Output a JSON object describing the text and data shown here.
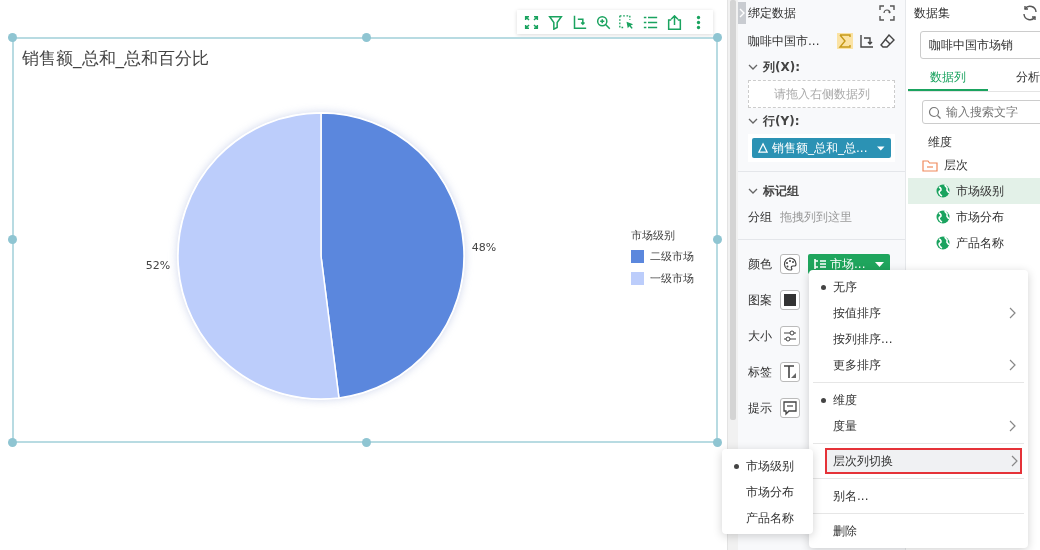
{
  "chart": {
    "title": "销售额_总和_总和百分比",
    "chart_data": {
      "type": "pie",
      "categories": [
        "二级市场",
        "一级市场"
      ],
      "series": [
        {
          "values": [
            48,
            52
          ]
        }
      ],
      "value_labels": [
        "48%",
        "52%"
      ]
    },
    "legend": {
      "title": "市场级别",
      "items": [
        {
          "color": "#5b87dd"
        },
        {
          "color": "#bccdfb"
        }
      ]
    }
  },
  "bind_panel": {
    "title": "绑定数据",
    "dataset_name": "咖啡中国市...",
    "sum_on": true,
    "columns": {
      "label": "列(X):",
      "placeholder": "请拖入右侧数据列"
    },
    "rows": {
      "label": "行(Y):",
      "field": "销售额_总和_总..."
    },
    "marks": {
      "label": "标记组",
      "group_label": "分组",
      "group_placeholder": "拖拽列到这里"
    },
    "properties": [
      {
        "label": "颜色",
        "kind": "palette",
        "field": "市场..."
      },
      {
        "label": "图案",
        "kind": "pattern"
      },
      {
        "label": "大小",
        "kind": "size"
      },
      {
        "label": "标签",
        "kind": "label"
      },
      {
        "label": "提示",
        "kind": "tooltip"
      }
    ]
  },
  "dataset_panel": {
    "title": "数据集",
    "dataset": "咖啡中国市场销",
    "tabs": [
      {
        "label": "数据列",
        "selected": true
      },
      {
        "label": "分析",
        "selected": false
      }
    ],
    "search": {
      "placeholder": "输入搜索文字"
    },
    "section": "维度",
    "tree": [
      {
        "label": "层次",
        "kind": "folder",
        "selected": false,
        "children": [
          {
            "label": "市场级别",
            "kind": "geo",
            "selected": true
          },
          {
            "label": "市场分布",
            "kind": "geo",
            "selected": false
          },
          {
            "label": "产品名称",
            "kind": "geo",
            "selected": false
          }
        ]
      }
    ]
  },
  "context_menu": {
    "groups": [
      [
        {
          "label": "无序",
          "selected": true,
          "submenu": false,
          "highlighted": false
        },
        {
          "label": "按值排序",
          "selected": false,
          "submenu": true,
          "highlighted": false
        },
        {
          "label": "按列排序...",
          "selected": false,
          "submenu": false,
          "highlighted": false
        },
        {
          "label": "更多排序",
          "selected": false,
          "submenu": true,
          "highlighted": false
        }
      ],
      [
        {
          "label": "维度",
          "selected": true,
          "submenu": false,
          "highlighted": false
        },
        {
          "label": "度量",
          "selected": false,
          "submenu": true,
          "highlighted": false
        }
      ],
      [
        {
          "label": "层次列切换",
          "selected": false,
          "submenu": true,
          "highlighted": true
        }
      ],
      [
        {
          "label": "别名...",
          "selected": false,
          "submenu": false,
          "highlighted": false
        }
      ],
      [
        {
          "label": "删除",
          "selected": false,
          "submenu": false,
          "highlighted": false
        }
      ]
    ]
  },
  "submenu": {
    "items": [
      {
        "label": "市场级别",
        "selected": true
      },
      {
        "label": "市场分布",
        "selected": false
      },
      {
        "label": "产品名称",
        "selected": false
      }
    ]
  }
}
